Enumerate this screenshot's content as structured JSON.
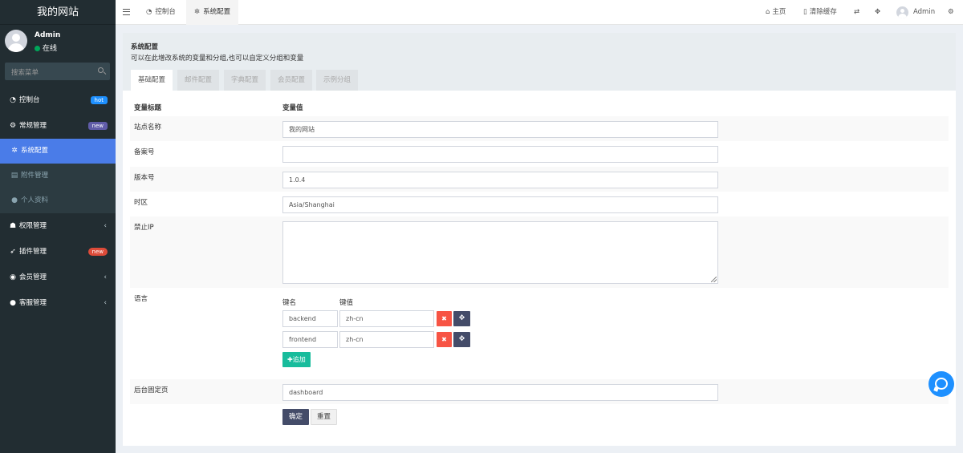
{
  "site": {
    "title": "我的网站"
  },
  "user": {
    "name": "Admin",
    "status": "在线"
  },
  "search": {
    "placeholder": "搜索菜单"
  },
  "menu": {
    "dashboard": {
      "label": "控制台",
      "badge": "hot",
      "badge_color": "#1e90ff"
    },
    "general": {
      "label": "常规管理",
      "badge": "new",
      "badge_color": "#605ca8"
    },
    "sub": [
      {
        "label": "系统配置"
      },
      {
        "label": "附件管理"
      },
      {
        "label": "个人资料"
      }
    ],
    "auth": {
      "label": "权限管理"
    },
    "plugins": {
      "label": "插件管理",
      "badge": "new",
      "badge_color": "#dd4b39"
    },
    "members": {
      "label": "会员管理"
    },
    "service": {
      "label": "客服管理"
    }
  },
  "header": {
    "tabs": [
      {
        "label": "控制台"
      },
      {
        "label": "系统配置"
      }
    ],
    "home": "主页",
    "clear_cache": "清除缓存",
    "admin": "Admin"
  },
  "page": {
    "title": "系统配置",
    "subtitle": "可以在此增改系统的变量和分组,也可以自定义分组和变量",
    "tabs": [
      {
        "label": "基础配置"
      },
      {
        "label": "邮件配置"
      },
      {
        "label": "字典配置"
      },
      {
        "label": "会员配置"
      },
      {
        "label": "示例分组"
      }
    ]
  },
  "form": {
    "col_title": "变量标题",
    "col_value": "变量值",
    "site_name_label": "站点名称",
    "site_name_value": "我的网站",
    "beian_label": "备案号",
    "beian_value": "",
    "version_label": "版本号",
    "version_value": "1.0.4",
    "timezone_label": "时区",
    "timezone_value": "Asia/Shanghai",
    "ban_ip_label": "禁止IP",
    "lang_label": "语言",
    "key_head": "键名",
    "val_head": "键值",
    "langs": [
      {
        "key": "backend",
        "value": "zh-cn"
      },
      {
        "key": "frontend",
        "value": "zh-cn"
      }
    ],
    "add_label": "追加",
    "fixed_page_label": "后台固定页",
    "fixed_page_value": "dashboard",
    "submit_label": "确定",
    "reset_label": "重置"
  },
  "colors": {
    "accent": "#4a7ce8",
    "sidebar": "#222d32",
    "danger": "#f75444",
    "success": "#18bc9c",
    "primary": "#444c69"
  }
}
